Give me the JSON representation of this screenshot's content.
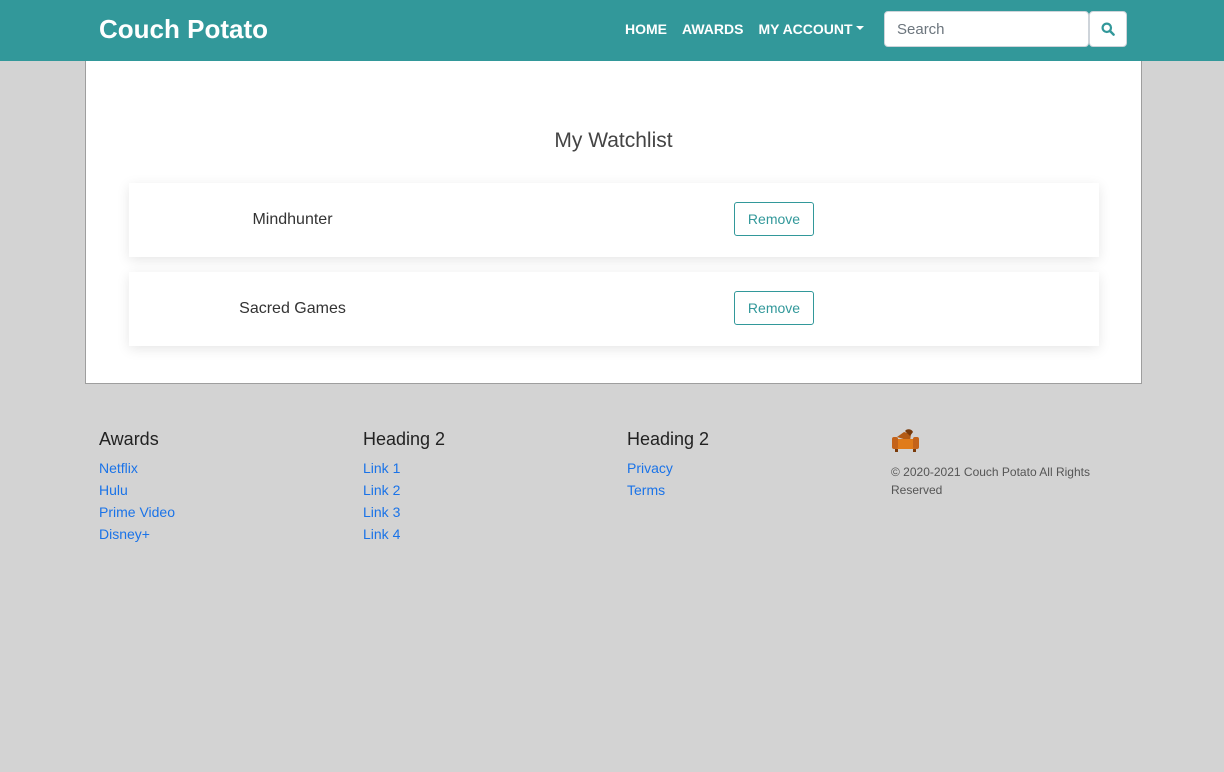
{
  "header": {
    "brand": "Couch Potato",
    "nav": {
      "home": "HOME",
      "awards": "AWARDS",
      "account": "MY ACCOUNT"
    },
    "search": {
      "placeholder": "Search",
      "value": ""
    },
    "colors": {
      "navbar": "#32989a",
      "accent": "#32989a",
      "link": "#1a73e8"
    }
  },
  "watchlist": {
    "title": "My Watchlist",
    "items": [
      {
        "title": "Mindhunter",
        "action": "Remove"
      },
      {
        "title": "Sacred Games",
        "action": "Remove"
      }
    ]
  },
  "footer": {
    "columns": [
      {
        "heading": "Awards",
        "links": [
          "Netflix",
          "Hulu",
          "Prime Video",
          "Disney+"
        ]
      },
      {
        "heading": "Heading 2",
        "links": [
          "Link 1",
          "Link 2",
          "Link 3",
          "Link 4"
        ]
      },
      {
        "heading": "Heading 2",
        "links": [
          "Privacy",
          "Terms"
        ]
      }
    ],
    "logo_icon": "couch-icon",
    "copyright": "© 2020-2021 Couch Potato All Rights Reserved"
  }
}
